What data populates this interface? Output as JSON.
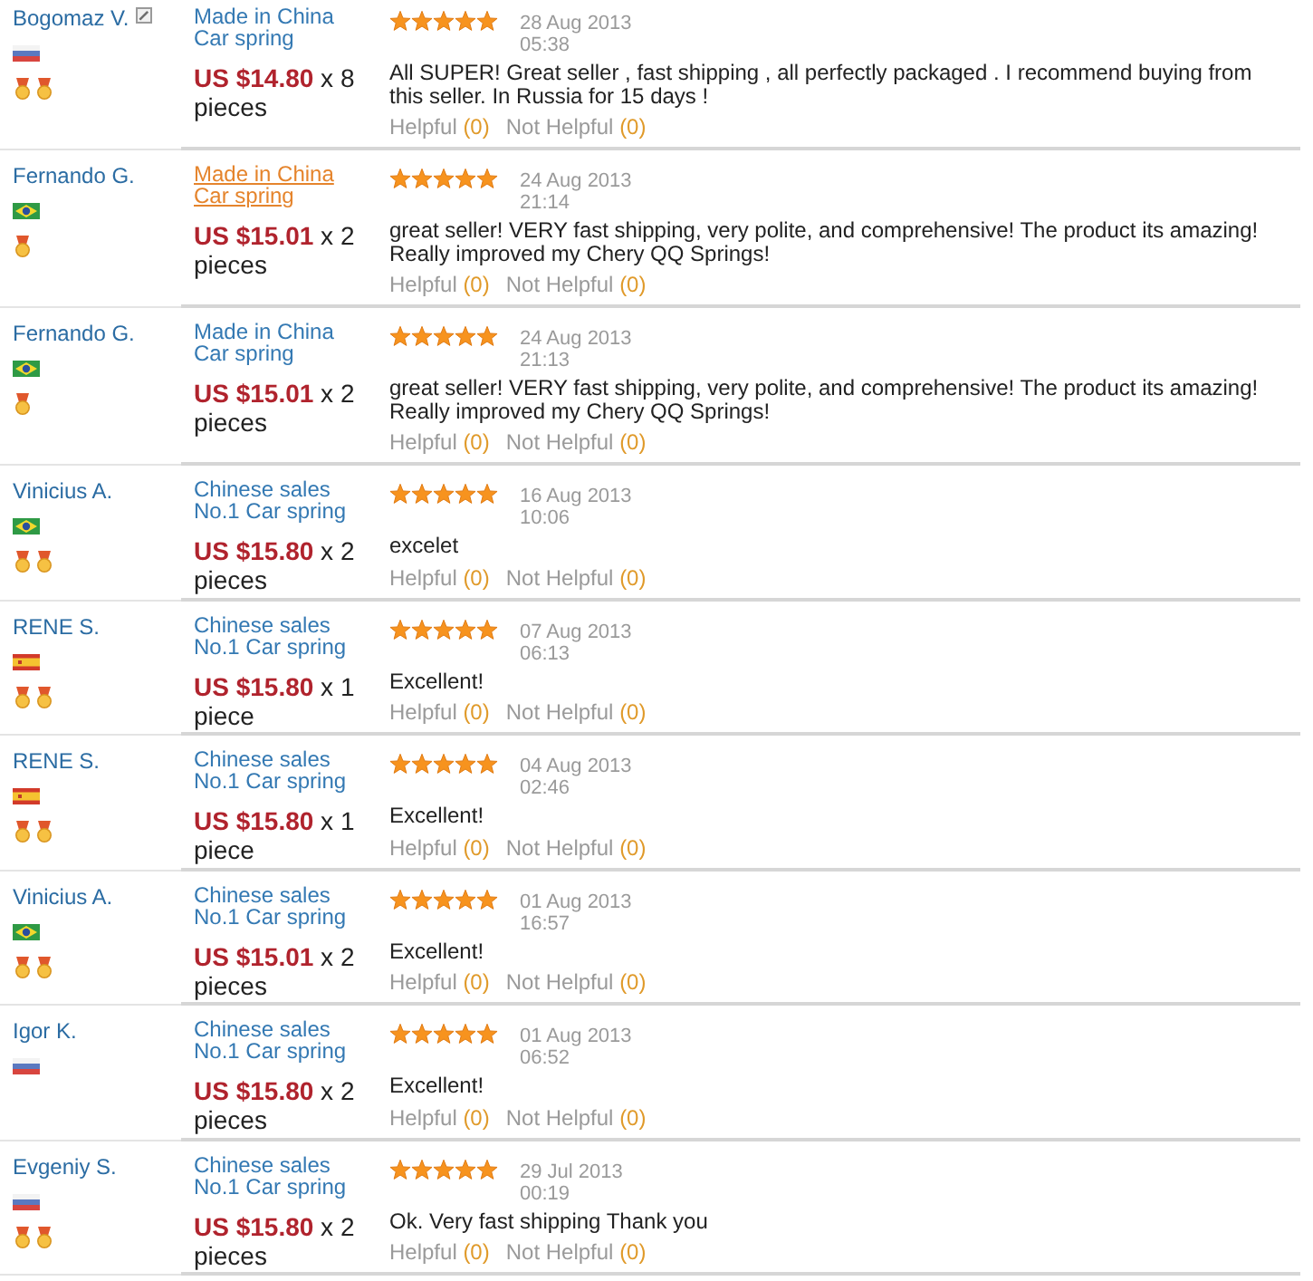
{
  "reviews": [
    {
      "reviewer": {
        "name": "Bogomaz V.",
        "note_icon": true,
        "flag": {
          "kind": "russia"
        },
        "medals": [
          {
            "kind": "medal"
          },
          {
            "kind": "medal"
          }
        ]
      },
      "product": {
        "title": "Made in China Car spring",
        "hovered": false
      },
      "order": {
        "price": "US $14.80",
        "quantity": "x 8 pieces"
      },
      "stars": 5,
      "date": "28 Aug 2013",
      "time": "05:38",
      "text": "All SUPER! Great seller , fast shipping , all perfectly packaged . I recommend buying from this seller. In Russia for 15 days !",
      "helpful": {
        "label": "Helpful",
        "count": "(0)"
      },
      "not_helpful": {
        "label": "Not Helpful",
        "count": "(0)"
      }
    },
    {
      "reviewer": {
        "name": "Fernando G.",
        "note_icon": false,
        "flag": {
          "kind": "brazil"
        },
        "medals": [
          {
            "kind": "medal"
          }
        ]
      },
      "product": {
        "title": "Made in China Car spring",
        "hovered": true
      },
      "order": {
        "price": "US $15.01",
        "quantity": "x 2 pieces"
      },
      "stars": 5,
      "date": "24 Aug 2013",
      "time": "21:14",
      "text": "great seller! VERY fast shipping, very polite, and comprehensive! The product its amazing! Really improved my Chery QQ Springs!",
      "helpful": {
        "label": "Helpful",
        "count": "(0)"
      },
      "not_helpful": {
        "label": "Not Helpful",
        "count": "(0)"
      }
    },
    {
      "reviewer": {
        "name": "Fernando G.",
        "note_icon": false,
        "flag": {
          "kind": "brazil"
        },
        "medals": [
          {
            "kind": "medal"
          }
        ]
      },
      "product": {
        "title": "Made in China Car spring",
        "hovered": false
      },
      "order": {
        "price": "US $15.01",
        "quantity": "x 2 pieces"
      },
      "stars": 5,
      "date": "24 Aug 2013",
      "time": "21:13",
      "text": "great seller! VERY fast shipping, very polite, and comprehensive! The product its amazing! Really improved my Chery QQ Springs!",
      "helpful": {
        "label": "Helpful",
        "count": "(0)"
      },
      "not_helpful": {
        "label": "Not Helpful",
        "count": "(0)"
      }
    },
    {
      "reviewer": {
        "name": "Vinicius A.",
        "note_icon": false,
        "flag": {
          "kind": "brazil"
        },
        "medals": [
          {
            "kind": "medal"
          },
          {
            "kind": "medal"
          }
        ]
      },
      "product": {
        "title": "Chinese sales No.1 Car spring",
        "hovered": false
      },
      "order": {
        "price": "US $15.80",
        "quantity": "x 2 pieces"
      },
      "stars": 5,
      "date": "16 Aug 2013",
      "time": "10:06",
      "text": "excelet",
      "helpful": {
        "label": "Helpful",
        "count": "(0)"
      },
      "not_helpful": {
        "label": "Not Helpful",
        "count": "(0)"
      }
    },
    {
      "reviewer": {
        "name": "RENE S.",
        "note_icon": false,
        "flag": {
          "kind": "spain"
        },
        "medals": [
          {
            "kind": "medal"
          },
          {
            "kind": "medal"
          }
        ]
      },
      "product": {
        "title": "Chinese sales No.1 Car spring",
        "hovered": false
      },
      "order": {
        "price": "US $15.80",
        "quantity": "x 1 piece"
      },
      "stars": 5,
      "date": "07 Aug 2013",
      "time": "06:13",
      "text": "Excellent!",
      "helpful": {
        "label": "Helpful",
        "count": "(0)"
      },
      "not_helpful": {
        "label": "Not Helpful",
        "count": "(0)"
      }
    },
    {
      "reviewer": {
        "name": "RENE S.",
        "note_icon": false,
        "flag": {
          "kind": "spain"
        },
        "medals": [
          {
            "kind": "medal"
          },
          {
            "kind": "medal"
          }
        ]
      },
      "product": {
        "title": "Chinese sales No.1 Car spring",
        "hovered": false
      },
      "order": {
        "price": "US $15.80",
        "quantity": "x 1 piece"
      },
      "stars": 5,
      "date": "04 Aug 2013",
      "time": "02:46",
      "text": "Excellent!",
      "helpful": {
        "label": "Helpful",
        "count": "(0)"
      },
      "not_helpful": {
        "label": "Not Helpful",
        "count": "(0)"
      }
    },
    {
      "reviewer": {
        "name": "Vinicius A.",
        "note_icon": false,
        "flag": {
          "kind": "brazil"
        },
        "medals": [
          {
            "kind": "medal"
          },
          {
            "kind": "medal"
          }
        ]
      },
      "product": {
        "title": "Chinese sales No.1 Car spring",
        "hovered": false
      },
      "order": {
        "price": "US $15.01",
        "quantity": "x 2 pieces"
      },
      "stars": 5,
      "date": "01 Aug 2013",
      "time": "16:57",
      "text": "Excellent!",
      "helpful": {
        "label": "Helpful",
        "count": "(0)"
      },
      "not_helpful": {
        "label": "Not Helpful",
        "count": "(0)"
      }
    },
    {
      "reviewer": {
        "name": "Igor K.",
        "note_icon": false,
        "flag": {
          "kind": "russia"
        }
      },
      "product": {
        "title": "Chinese sales No.1 Car spring",
        "hovered": false
      },
      "order": {
        "price": "US $15.80",
        "quantity": "x 2 pieces"
      },
      "stars": 5,
      "date": "01 Aug 2013",
      "time": "06:52",
      "text": "Excellent!",
      "helpful": {
        "label": "Helpful",
        "count": "(0)"
      },
      "not_helpful": {
        "label": "Not Helpful",
        "count": "(0)"
      }
    },
    {
      "reviewer": {
        "name": "Evgeniy S.",
        "note_icon": false,
        "flag": {
          "kind": "russia"
        },
        "medals": [
          {
            "kind": "medal"
          },
          {
            "kind": "medal"
          }
        ]
      },
      "product": {
        "title": "Chinese sales No.1 Car spring",
        "hovered": false
      },
      "order": {
        "price": "US $15.80",
        "quantity": "x 2 pieces"
      },
      "stars": 5,
      "date": "29 Jul 2013",
      "time": "00:19",
      "text": "Ok. Very fast shipping Thank you",
      "helpful": {
        "label": "Helpful",
        "count": "(0)"
      },
      "not_helpful": {
        "label": "Not Helpful",
        "count": "(0)"
      }
    }
  ]
}
